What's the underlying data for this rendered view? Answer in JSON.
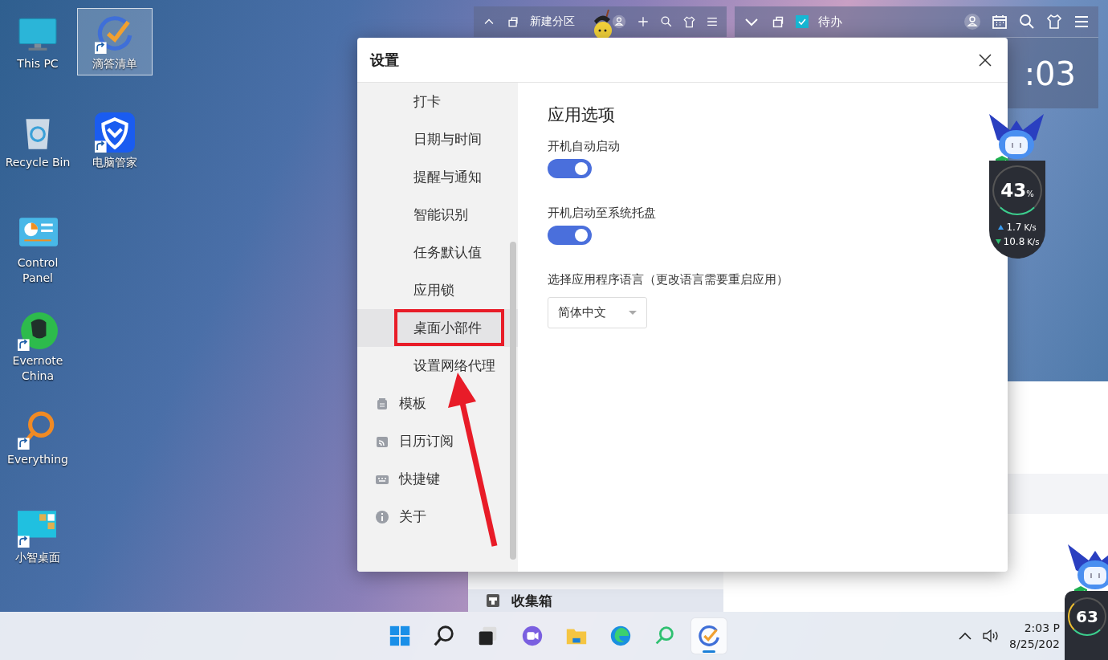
{
  "desktop_icons": [
    {
      "label": "This PC",
      "selected": false
    },
    {
      "label": "滴答清单",
      "selected": true
    },
    {
      "label": "Recycle Bin",
      "selected": false
    },
    {
      "label": "电脑管家",
      "selected": false
    },
    {
      "label": "Control Panel",
      "selected": false
    },
    {
      "label": "Evernote China",
      "selected": false
    },
    {
      "label": "Everything",
      "selected": false
    },
    {
      "label": "小智桌面",
      "selected": false
    }
  ],
  "partition_bar": {
    "title": "新建分区"
  },
  "todo_bar": {
    "title": "待办",
    "checked": true,
    "clock": ":03"
  },
  "collection_item": {
    "label": "收集箱"
  },
  "net_monitor": {
    "percent": "43",
    "unit": "%",
    "upload": "1.7",
    "upload_unit": "K/s",
    "download": "10.8",
    "download_unit": "K/s"
  },
  "net_monitor_corner": {
    "percent": "63"
  },
  "settings": {
    "title": "设置",
    "sidebar": [
      {
        "label": "打卡",
        "kind": "sub",
        "selected": false
      },
      {
        "label": "日期与时间",
        "kind": "sub",
        "selected": false
      },
      {
        "label": "提醒与通知",
        "kind": "sub",
        "selected": false
      },
      {
        "label": "智能识别",
        "kind": "sub",
        "selected": false
      },
      {
        "label": "任务默认值",
        "kind": "sub",
        "selected": false
      },
      {
        "label": "应用锁",
        "kind": "sub",
        "selected": false
      },
      {
        "label": "桌面小部件",
        "kind": "sub",
        "selected": true
      },
      {
        "label": "设置网络代理",
        "kind": "sub",
        "selected": false
      },
      {
        "label": "模板",
        "kind": "section",
        "selected": false
      },
      {
        "label": "日历订阅",
        "kind": "section",
        "selected": false
      },
      {
        "label": "快捷键",
        "kind": "section",
        "selected": false
      },
      {
        "label": "关于",
        "kind": "section",
        "selected": false
      }
    ],
    "section_title": "应用选项",
    "options": [
      {
        "kind": "toggle",
        "label": "开机自动启动",
        "on": true
      },
      {
        "kind": "toggle",
        "label": "开机启动至系统托盘",
        "on": true
      },
      {
        "kind": "select",
        "label": "选择应用程序语言（更改语言需要重启应用）",
        "value": "简体中文"
      }
    ]
  },
  "taskbar": {
    "apps": [
      {
        "selected": false
      },
      {
        "selected": false
      },
      {
        "selected": false
      },
      {
        "selected": false
      },
      {
        "selected": false
      },
      {
        "selected": false
      },
      {
        "selected": false
      },
      {
        "selected": true
      }
    ],
    "time": "2:03 P",
    "date": "8/25/202"
  }
}
